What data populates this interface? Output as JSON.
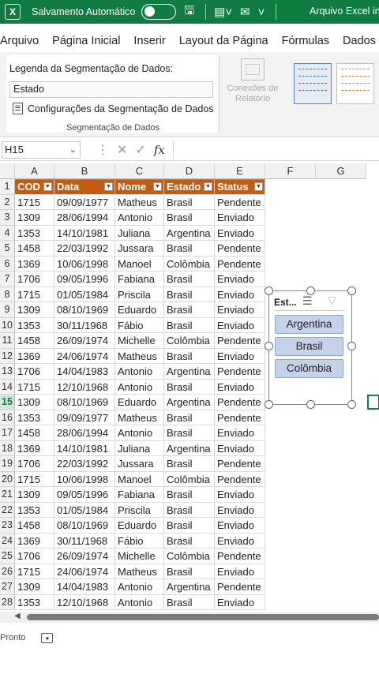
{
  "titlebar": {
    "logo": "X",
    "autosave_label": "Salvamento Automático",
    "autosave_state": "off",
    "icons": [
      "save-icon",
      "form-icon",
      "mail-icon",
      "more-icon"
    ],
    "filename": "Arquivo Excel ins"
  },
  "menu": [
    "Arquivo",
    "Página Inicial",
    "Inserir",
    "Layout da Página",
    "Fórmulas",
    "Dados"
  ],
  "ribbon": {
    "caption_label": "Legenda da Segmentação de Dados:",
    "caption_value": "Estado",
    "settings_label": "Configurações da Segmentação de Dados",
    "group_label": "Segmentação de Dados",
    "conexoes_label": "Conexões de Relatório"
  },
  "formula": {
    "namebox": "H15",
    "fx": "fx",
    "content": ""
  },
  "columns": [
    "A",
    "B",
    "C",
    "D",
    "E",
    "F",
    "G"
  ],
  "table": {
    "headers": [
      "COD",
      "Data",
      "Nome",
      "Estado",
      "Status"
    ],
    "rows": [
      [
        "1715",
        "09/09/1977",
        "Matheus",
        "Brasil",
        "Pendente"
      ],
      [
        "1309",
        "28/06/1994",
        "Antonio",
        "Brasil",
        "Enviado"
      ],
      [
        "1353",
        "14/10/1981",
        "Juliana",
        "Argentina",
        "Enviado"
      ],
      [
        "1458",
        "22/03/1992",
        "Jussara",
        "Brasil",
        "Pendente"
      ],
      [
        "1369",
        "10/06/1998",
        "Manoel",
        "Colômbia",
        "Pendente"
      ],
      [
        "1706",
        "09/05/1996",
        "Fabiana",
        "Brasil",
        "Enviado"
      ],
      [
        "1715",
        "01/05/1984",
        "Priscila",
        "Brasil",
        "Enviado"
      ],
      [
        "1309",
        "08/10/1969",
        "Eduardo",
        "Brasil",
        "Enviado"
      ],
      [
        "1353",
        "30/11/1968",
        "Fábio",
        "Brasil",
        "Enviado"
      ],
      [
        "1458",
        "26/09/1974",
        "Michelle",
        "Colômbia",
        "Pendente"
      ],
      [
        "1369",
        "24/06/1974",
        "Matheus",
        "Brasil",
        "Enviado"
      ],
      [
        "1706",
        "14/04/1983",
        "Antonio",
        "Argentina",
        "Pendente"
      ],
      [
        "1715",
        "12/10/1968",
        "Antonio",
        "Brasil",
        "Enviado"
      ],
      [
        "1309",
        "08/10/1969",
        "Eduardo",
        "Argentina",
        "Pendente"
      ],
      [
        "1353",
        "09/09/1977",
        "Matheus",
        "Brasil",
        "Pendente"
      ],
      [
        "1458",
        "28/06/1994",
        "Antonio",
        "Brasil",
        "Enviado"
      ],
      [
        "1369",
        "14/10/1981",
        "Juliana",
        "Argentina",
        "Enviado"
      ],
      [
        "1706",
        "22/03/1992",
        "Jussara",
        "Brasil",
        "Pendente"
      ],
      [
        "1715",
        "10/06/1998",
        "Manoel",
        "Colômbia",
        "Pendente"
      ],
      [
        "1309",
        "09/05/1996",
        "Fabiana",
        "Brasil",
        "Enviado"
      ],
      [
        "1353",
        "01/05/1984",
        "Priscila",
        "Brasil",
        "Enviado"
      ],
      [
        "1458",
        "08/10/1969",
        "Eduardo",
        "Brasil",
        "Enviado"
      ],
      [
        "1369",
        "30/11/1968",
        "Fábio",
        "Brasil",
        "Enviado"
      ],
      [
        "1706",
        "26/09/1974",
        "Michelle",
        "Colômbia",
        "Pendente"
      ],
      [
        "1715",
        "24/06/1974",
        "Matheus",
        "Brasil",
        "Enviado"
      ],
      [
        "1309",
        "14/04/1983",
        "Antonio",
        "Argentina",
        "Pendente"
      ],
      [
        "1353",
        "12/10/1968",
        "Antonio",
        "Brasil",
        "Enviado"
      ]
    ]
  },
  "selected_row": 15,
  "slicer": {
    "header": "Est...",
    "items": [
      "Argentina",
      "Brasil",
      "Colômbia"
    ]
  },
  "status": {
    "text": "Pronto"
  },
  "colors": {
    "excel_green": "#107c41",
    "table_header": "#c55a11",
    "slicer_item": "#c5d3ea"
  }
}
